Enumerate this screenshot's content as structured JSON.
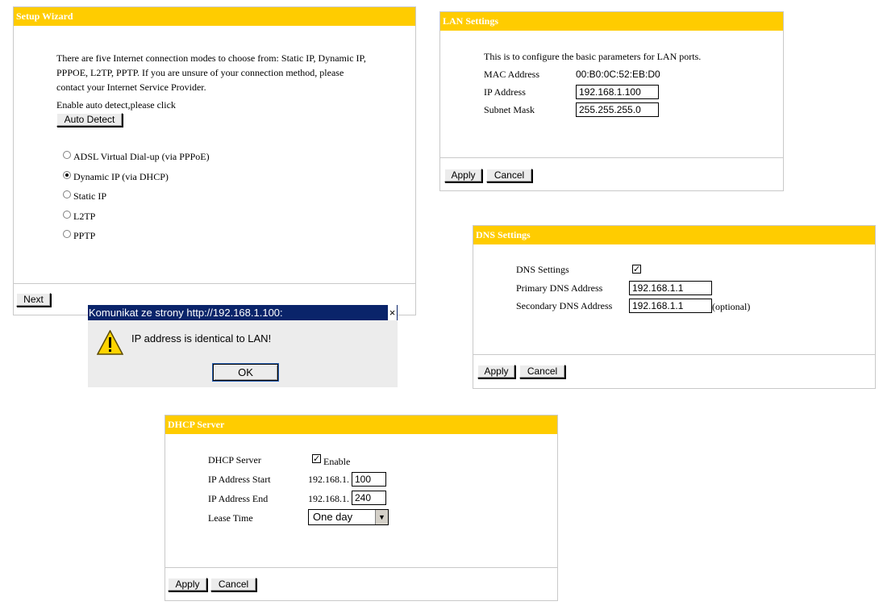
{
  "setup_wizard": {
    "title": "Setup Wizard",
    "intro": [
      "There are five Internet connection modes to choose from: Static IP, Dynamic IP,",
      "PPPOE, L2TP, PPTP. If you are unsure of your connection method, please",
      "contact your Internet Service Provider."
    ],
    "auto_detect_text": "Enable auto detect,please click",
    "auto_detect_button": "Auto Detect",
    "modes": [
      {
        "label": "ADSL Virtual Dial-up (via PPPoE)",
        "selected": false
      },
      {
        "label": "Dynamic IP (via DHCP)",
        "selected": true
      },
      {
        "label": "Static IP",
        "selected": false
      },
      {
        "label": "L2TP",
        "selected": false
      },
      {
        "label": "PPTP",
        "selected": false
      }
    ],
    "next_button": "Next"
  },
  "lan": {
    "title": "LAN Settings",
    "description": "This is to configure the basic parameters for LAN ports.",
    "mac_label": "MAC Address",
    "mac_value": "00:B0:0C:52:EB:D0",
    "ip_label": "IP Address",
    "ip_value": "192.168.1.100",
    "mask_label": "Subnet Mask",
    "mask_value": "255.255.255.0",
    "apply_button": "Apply",
    "cancel_button": "Cancel"
  },
  "dns": {
    "title": "DNS Settings",
    "enable_label": "DNS Settings",
    "enabled": true,
    "primary_label": "Primary DNS Address",
    "primary_value": "192.168.1.1",
    "secondary_label": "Secondary DNS Address",
    "secondary_value": "192.168.1.1",
    "optional_text": "(optional)",
    "apply_button": "Apply",
    "cancel_button": "Cancel"
  },
  "dialog": {
    "title": "Komunikat ze strony http://192.168.1.100:",
    "message": "IP address is identical to LAN!",
    "ok_button": "OK",
    "close_glyph": "×",
    "icon": "warning-icon"
  },
  "dhcp": {
    "title": "DHCP Server",
    "server_label": "DHCP Server",
    "enable_label": "Enable",
    "enabled": true,
    "start_label": "IP Address Start",
    "end_label": "IP Address End",
    "prefix": "192.168.1.",
    "start_value": "100",
    "end_value": "240",
    "lease_label": "Lease Time",
    "lease_value": "One day",
    "apply_button": "Apply",
    "cancel_button": "Cancel"
  },
  "colors": {
    "header_bar": "#ffcc00",
    "dialog_title": "#0a246a"
  }
}
